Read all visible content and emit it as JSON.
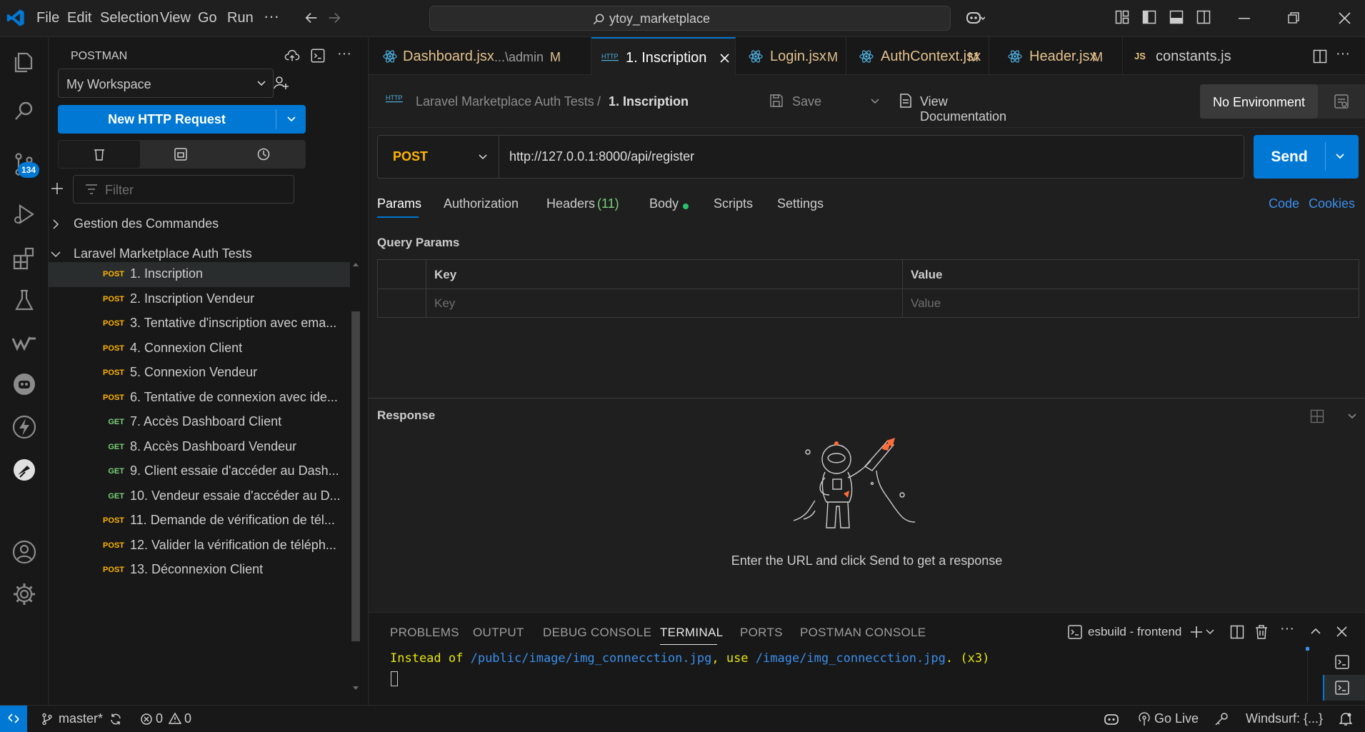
{
  "menu": {
    "file": "File",
    "edit": "Edit",
    "selection": "Selection",
    "view": "View",
    "go": "Go",
    "run": "Run",
    "more": "···"
  },
  "search": {
    "value": "ytoy_marketplace"
  },
  "sidebar": {
    "title": "POSTMAN",
    "workspace": "My Workspace",
    "new_request": "New HTTP Request",
    "filter_placeholder": "Filter",
    "collections": [
      {
        "label": "Gestion des Commandes",
        "expanded": false
      },
      {
        "label": "Laravel Marketplace Auth Tests",
        "expanded": true
      }
    ],
    "requests": [
      {
        "method": "POST",
        "label": "1. Inscription"
      },
      {
        "method": "POST",
        "label": "2. Inscription Vendeur"
      },
      {
        "method": "POST",
        "label": "3. Tentative d'inscription avec ema..."
      },
      {
        "method": "POST",
        "label": "4. Connexion Client"
      },
      {
        "method": "POST",
        "label": "5. Connexion Vendeur"
      },
      {
        "method": "POST",
        "label": "6. Tentative de connexion avec ide..."
      },
      {
        "method": "GET",
        "label": "7. Accès Dashboard Client"
      },
      {
        "method": "GET",
        "label": "8. Accès Dashboard Vendeur"
      },
      {
        "method": "GET",
        "label": "9. Client essaie d'accéder au Dash..."
      },
      {
        "method": "GET",
        "label": "10. Vendeur essaie d'accéder au D..."
      },
      {
        "method": "POST",
        "label": "11. Demande de vérification de tél..."
      },
      {
        "method": "POST",
        "label": "12. Valider la vérification de téléph..."
      },
      {
        "method": "POST",
        "label": "13. Déconnexion Client"
      }
    ]
  },
  "activity": {
    "scm_badge": "134"
  },
  "tabs": [
    {
      "label": "Dashboard.jsx",
      "detail": "...\\admin",
      "status": "M"
    },
    {
      "label": "1. Inscription",
      "detail": "",
      "status": ""
    },
    {
      "label": "Login.jsx",
      "detail": "",
      "status": "M"
    },
    {
      "label": "AuthContext.jsx",
      "detail": "",
      "status": "M"
    },
    {
      "label": "Header.jsx",
      "detail": "",
      "status": "M"
    },
    {
      "label": "constants.js",
      "detail": "",
      "status": ""
    }
  ],
  "tab_icon_js": "JS",
  "request": {
    "breadcrumb_collection": "Laravel Marketplace Auth Tests",
    "breadcrumb_sep": "/",
    "breadcrumb_request": "1. Inscription",
    "save": "Save",
    "view_docs": "View Documentation",
    "environment": "No Environment",
    "method": "POST",
    "url": "http://127.0.0.1:8000/api/register",
    "send": "Send",
    "tabs": {
      "params": "Params",
      "authorization": "Authorization",
      "headers": "Headers",
      "headers_count": "(11)",
      "body": "Body",
      "scripts": "Scripts",
      "settings": "Settings"
    },
    "code": "Code",
    "cookies": "Cookies",
    "query_params_title": "Query Params",
    "table_key_header": "Key",
    "table_value_header": "Value",
    "key_placeholder": "Key",
    "value_placeholder": "Value"
  },
  "response": {
    "title": "Response",
    "hint": "Enter the URL and click Send to get a response"
  },
  "panel": {
    "tabs": [
      "PROBLEMS",
      "OUTPUT",
      "DEBUG CONSOLE",
      "TERMINAL",
      "PORTS",
      "POSTMAN CONSOLE"
    ],
    "terminal_name": "esbuild - frontend",
    "terminal_line": {
      "p1": "Instead of ",
      "p2": "/public/image/img_connecction.jpg",
      "p3": ", use ",
      "p4": "/image/img_connecction.jpg",
      "p5": ". (x3)"
    }
  },
  "status": {
    "branch": "master*",
    "errors": "0",
    "warnings": "0",
    "go_live": "Go Live",
    "windsurf": "Windsurf: {...}"
  },
  "colors": {
    "accent": "#0078d4",
    "post": "#ffb400",
    "get": "#7ad07a",
    "react": "#4fb0e0",
    "modified": "#e2c08d",
    "status_remote": "#0078d4",
    "terminal_yellow": "#e5e510",
    "terminal_blue": "#3b8eea"
  }
}
